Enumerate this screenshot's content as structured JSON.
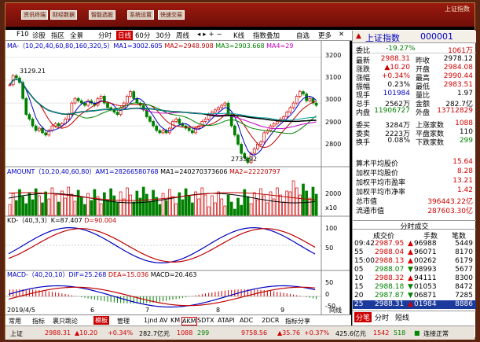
{
  "menu": {
    "buttons": [
      "资讯终端",
      "财经数据",
      "智能选股",
      "系统设置",
      "快速交易"
    ],
    "right_label": "上证指数"
  },
  "toolbar": {
    "items": [
      "F10",
      "诊股",
      "指区",
      "全景",
      "分时",
      "日线",
      "60分",
      "30分",
      "周线",
      "K线",
      "指数叠加",
      "自选",
      "更多"
    ],
    "selected": "日线"
  },
  "main_chart": {
    "ma_label": "MA-（10,20,40,60,80,160,320,5）MA1=3002.605",
    "ma2_label": "MA2=2948.908",
    "ma3_label": "MA3=2903.668",
    "ma4_label": "MA4=29",
    "high_label": "3129.21",
    "low_label": "2733.92",
    "y_ticks": [
      "3200",
      "3100",
      "3000",
      "2900",
      "2800"
    ]
  },
  "amount_chart": {
    "label": "AMOUNT（10,20,40,60,80）AM1=28266580768",
    "ma1": "MA1=240270373606",
    "ma2": "MA2=22220797",
    "y_tick": "2000",
    "unit": "x10"
  },
  "kd_chart": {
    "label": "KD-（40,3,3）K=87.407",
    "d": "D=90.004",
    "y_ticks": [
      "100",
      "50"
    ]
  },
  "macd_chart": {
    "label": "MACD-（40,20,10）DIF=25.268",
    "dea": "DEA=15.036",
    "macd": "MACD=20.463",
    "y_ticks": [
      "50",
      "0",
      "-50"
    ]
  },
  "x_axis": {
    "labels": [
      "2019/4/5",
      "6",
      "7",
      "8",
      "9"
    ],
    "trail": "间线"
  },
  "bottom_tabs": [
    "常用",
    "指标",
    "裹只跳论",
    "模板",
    "管理",
    "1jnd",
    "AV",
    "KM",
    "AKM",
    "SDTX",
    "ATAPI",
    "ADC",
    "2DCR",
    "指标分享"
  ],
  "bottom_tab_selected": "模板",
  "quote": {
    "name": "上证指数",
    "code": "000001",
    "weibi": "委比",
    "weibi_val": "-19.27%",
    "weicha_val": "1061万",
    "rows": [
      {
        "l1": "最新",
        "v1": "2988.31",
        "l2": "昨收",
        "v2": "2978.12",
        "c1": "r",
        "c2": "k"
      },
      {
        "l1": "涨跌",
        "v1": "▲10.20",
        "l2": "开盘",
        "v2": "2984.08",
        "c1": "r",
        "c2": "r"
      },
      {
        "l1": "涨幅",
        "v1": "+0.34%",
        "l2": "最高",
        "v2": "2990.44",
        "c1": "r",
        "c2": "r"
      },
      {
        "l1": "振幅",
        "v1": "0.23%",
        "l2": "最低",
        "v2": "2983.51",
        "c1": "k",
        "c2": "r"
      },
      {
        "l1": "现手",
        "v1": "101984",
        "l2": "量比",
        "v2": "1.97",
        "c1": "b",
        "c2": "k"
      },
      {
        "l1": "总手",
        "v1": "2562万",
        "l2": "金额",
        "v2": "282.7亿",
        "c1": "k",
        "c2": "k"
      },
      {
        "l1": "内盘",
        "v1": "11906727",
        "l2": "外盘",
        "v2": "13712829",
        "c1": "g",
        "c2": "r"
      }
    ],
    "rows2": [
      {
        "l1": "委买",
        "v1": "3284万",
        "l2": "上涨家数",
        "v2": "1088",
        "c1": "k",
        "c2": "r"
      },
      {
        "l1": "委卖",
        "v1": "2223万",
        "l2": "平盘家数",
        "v2": "110",
        "c1": "k",
        "c2": "k"
      },
      {
        "l1": "换手",
        "v1": "0.08%",
        "l2": "下跌家数",
        "v2": "299",
        "c1": "k",
        "c2": "g"
      }
    ],
    "rows3": [
      {
        "l": "算术平均股价",
        "v": "15.64"
      },
      {
        "l": "加权平均股价",
        "v": "8.28"
      },
      {
        "l": "加权平均市盈率",
        "v": "13.21"
      },
      {
        "l": "加权平均市净率",
        "v": "1.42"
      },
      {
        "l": "总市值",
        "v": "396443.22亿"
      },
      {
        "l": "流通市值",
        "v": "287603.30亿"
      }
    ]
  },
  "ticks": {
    "title": "分时成交",
    "headers": [
      "时间",
      "成交价",
      "手数",
      "笔数"
    ],
    "rows": [
      {
        "t": "09:42",
        "p": "2987.95",
        "d": "▲",
        "v": "96988",
        "n": "5449"
      },
      {
        "t": "55",
        "p": "2988.04",
        "d": "▲",
        "v": "96071",
        "n": "8170"
      },
      {
        "t": "15:00",
        "p": "2988.13",
        "d": "▲",
        "v": "00262",
        "n": "6179"
      },
      {
        "t": "05",
        "p": "2988.07",
        "d": "▼",
        "v": "98993",
        "n": "5677"
      },
      {
        "t": "10",
        "p": "2988.32",
        "d": "▲",
        "v": "94111",
        "n": "8300"
      },
      {
        "t": "15",
        "p": "2988.18",
        "d": "▼",
        "v": "01053",
        "n": "8472"
      },
      {
        "t": "20",
        "p": "2987.87",
        "d": "▼",
        "v": "06871",
        "n": "7285"
      },
      {
        "t": "25",
        "p": "2988.31",
        "d": "▲",
        "v": "01984",
        "n": "8886"
      }
    ],
    "tabs": [
      "分笔",
      "分时",
      "短线"
    ],
    "tab_selected": "分笔"
  },
  "status_bar": {
    "name": "上证",
    "price": "2988.31",
    "chg": "▲10.20",
    "pct": "+0.34%",
    "amt": "282.7亿元",
    "up": "1088",
    "down": "299",
    "price2": "9758.56",
    "chg2": "▲35.76",
    "pct2": "+0.37%",
    "amt2": "425.6亿元",
    "up2": "1542",
    "down2": "518",
    "conn": "连接正常"
  },
  "colors": {
    "up": "#d00000",
    "down": "#008000",
    "accent": "#c00000"
  }
}
